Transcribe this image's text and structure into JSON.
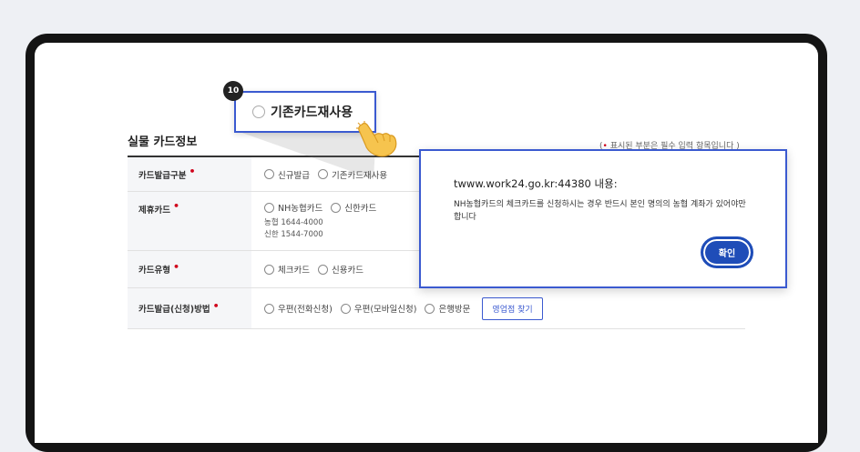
{
  "guide": {
    "step": "10",
    "highlight_label": "기존카드재사용"
  },
  "section": {
    "title": "실물 카드정보",
    "required_note_prefix": "(",
    "required_note_dot": "•",
    "required_note": "표시된 부분은 필수 입력 항목입니다 )"
  },
  "form": {
    "rows": [
      {
        "label": "카드발급구분",
        "options": [
          "신규발급",
          "기존카드재사용"
        ]
      },
      {
        "label": "제휴카드",
        "options": [
          "NH농협카드",
          "신한카드"
        ],
        "phones": [
          "농협 1644-4000",
          "신한 1544-7000"
        ]
      },
      {
        "label": "카드유형",
        "options": [
          "체크카드",
          "신용카드"
        ]
      },
      {
        "label": "카드발급(신청)방법",
        "options": [
          "우편(전화신청)",
          "우편(모바일신청)",
          "은행방문"
        ],
        "button": "영업점 찾기"
      }
    ],
    "required_mark": "•"
  },
  "alert": {
    "origin": "twww.work24.go.kr:44380 내용:",
    "message": "NH농협카드의 체크카드를 신청하시는 경우 반드시 본인 명의의 농협 계좌가 있어야만 합니다",
    "ok_label": "확인"
  },
  "colors": {
    "accent": "#3b5ad0",
    "required": "#d0021b",
    "button": "#1f4db8"
  }
}
